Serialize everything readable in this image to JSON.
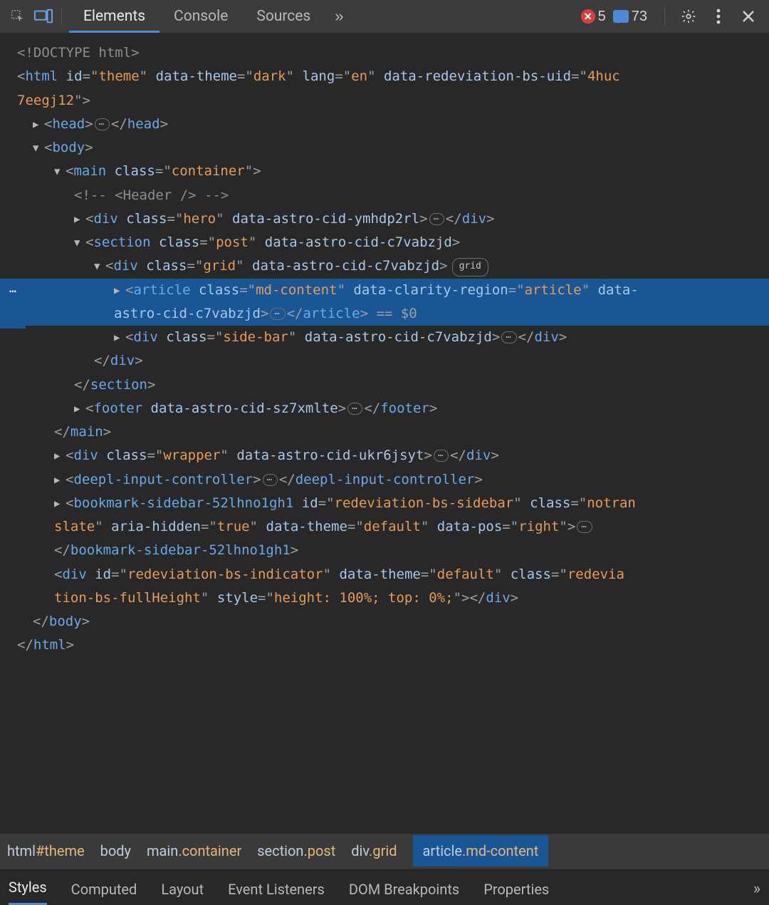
{
  "toolbar": {
    "tabs": [
      "Elements",
      "Console",
      "Sources"
    ],
    "active_tab": 0,
    "errors": "5",
    "messages": "73"
  },
  "dom": {
    "doctype": "<!DOCTYPE html>",
    "html_open_parts": {
      "id": "theme",
      "data_theme": "dark",
      "lang": "en",
      "uid_attr": "data-redeviation-bs-uid",
      "uid_val_p1": "4huc",
      "uid_val_p2": "7eegj12"
    },
    "head": "head",
    "body": "body",
    "main_cls": "container",
    "header_comment": "<!-- <Header /> -->",
    "hero_cls": "hero",
    "hero_cid": "data-astro-cid-ymhdp2rl",
    "section_cls": "post",
    "section_cid": "data-astro-cid-c7vabzjd",
    "grid_cls": "grid",
    "grid_badge": "grid",
    "article_cls": "md-content",
    "article_region_attr": "data-clarity-region",
    "article_region_val": "article",
    "article_suffix": "data-",
    "astro_cont": "astro-cid-c7vabzjd",
    "eq0": " == $0",
    "sidebar_cls": "side-bar",
    "footer_cid": "data-astro-cid-sz7xmlte",
    "wrapper_cls": "wrapper",
    "wrapper_cid": "data-astro-cid-ukr6jsyt",
    "deepl": "deepl-input-controller",
    "bm_tag": "bookmark-sidebar-52lhno1gh1",
    "bm_id": "redeviation-bs-sidebar",
    "bm_cls_p1": "notran",
    "bm_cls_p2": "slate",
    "bm_hidden": "true",
    "bm_theme": "default",
    "bm_pos": "right",
    "ind_id": "redeviation-bs-indicator",
    "ind_theme": "default",
    "ind_cls_p1": "redevia",
    "ind_cls_p2": "tion-bs-fullHeight",
    "ind_style": "height: 100%; top: 0%;"
  },
  "breadcrumbs": [
    {
      "tag": "html",
      "sel": "#theme"
    },
    {
      "tag": "body",
      "sel": ""
    },
    {
      "tag": "main",
      "sel": ".container"
    },
    {
      "tag": "section",
      "sel": ".post"
    },
    {
      "tag": "div",
      "sel": ".grid"
    },
    {
      "tag": "article",
      "sel": ".md-content"
    }
  ],
  "breadcrumb_active": 5,
  "subtabs": [
    "Styles",
    "Computed",
    "Layout",
    "Event Listeners",
    "DOM Breakpoints",
    "Properties"
  ],
  "subtab_active": 0
}
